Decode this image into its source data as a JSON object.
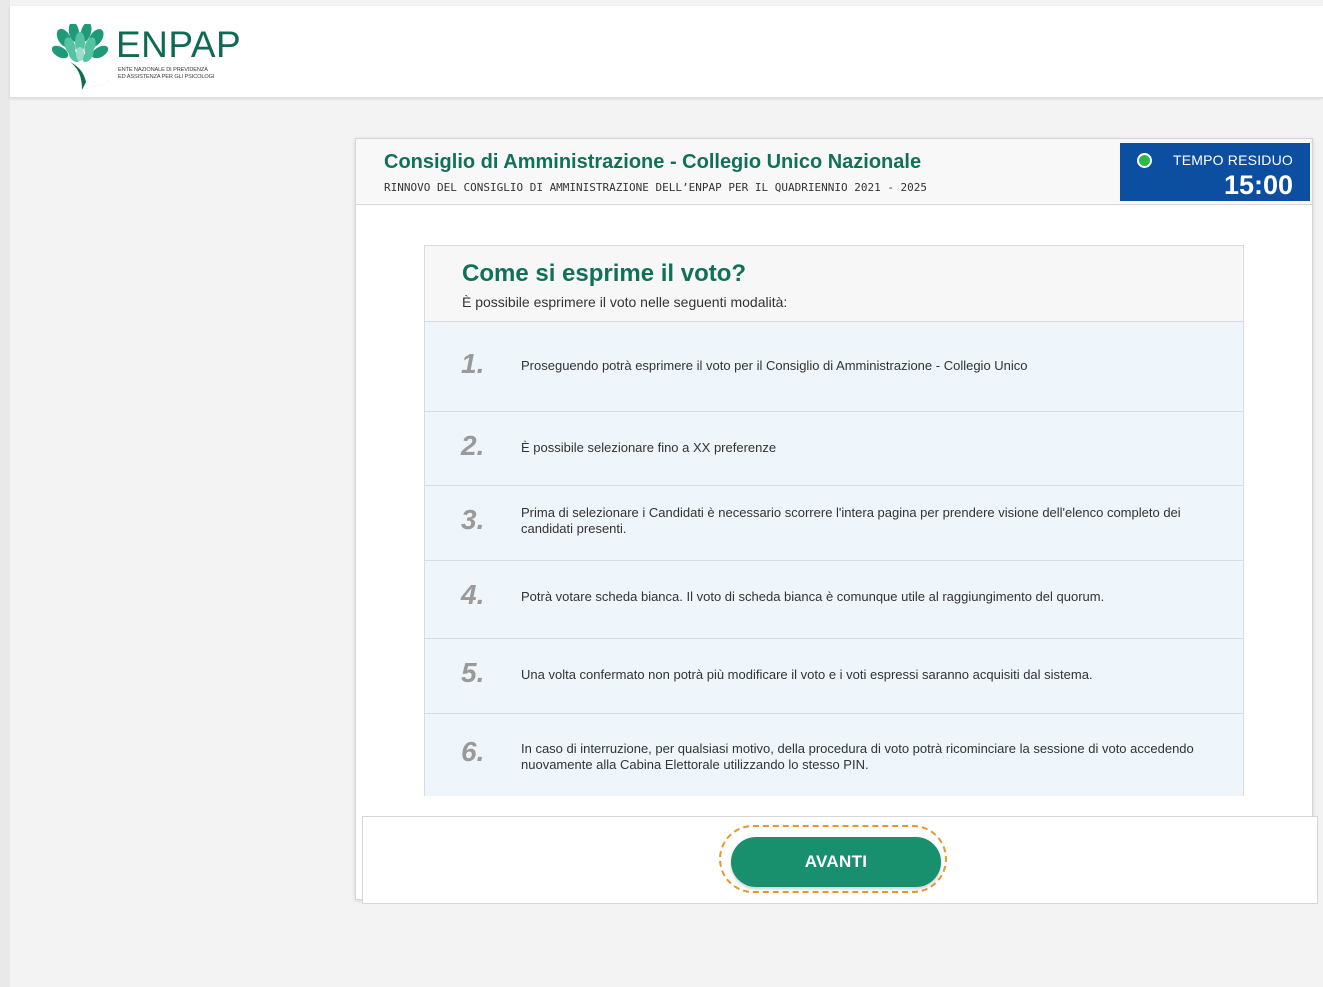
{
  "brand": {
    "name": "ENPAP",
    "subtitle_line1": "ENTE NAZIONALE DI PREVIDENZA",
    "subtitle_line2": "ED ASSISTENZA PER GLI PSICOLOGI",
    "color": "#0e6a52"
  },
  "panel": {
    "title": "Consiglio di Amministrazione - Collegio Unico Nazionale",
    "subtitle": "RINNOVO DEL CONSIGLIO DI AMMINISTRAZIONE DELL’ENPAP PER IL QUADRIENNIO  2021 - 2025"
  },
  "timer": {
    "label": "TEMPO RESIDUO",
    "value": "15:00",
    "status_color": "#2db84a",
    "bg_color": "#0c4ea0"
  },
  "info": {
    "title": "Come si esprime il voto?",
    "description": "È possibile esprimere il voto nelle seguenti modalità:",
    "items": [
      {
        "num": "1.",
        "text": "Proseguendo potrà esprimere il voto per il Consiglio di Amministrazione - Collegio Unico"
      },
      {
        "num": "2.",
        "text": "È possibile selezionare fino a XX preferenze"
      },
      {
        "num": "3.",
        "text": "Prima di selezionare i Candidati è necessario scorrere l'intera pagina per prendere visione dell'elenco completo dei candidati presenti."
      },
      {
        "num": "4.",
        "text": "Potrà votare scheda bianca. Il voto di scheda bianca è comunque utile al raggiungimento del quorum."
      },
      {
        "num": "5.",
        "text": "Una volta confermato non potrà più modificare il voto e i voti espressi saranno acquisiti dal sistema."
      },
      {
        "num": "6.",
        "text": "In caso di interruzione, per qualsiasi motivo, della procedura di voto potrà ricominciare la sessione di voto accedendo nuovamente alla Cabina Elettorale utilizzando lo stesso PIN."
      }
    ]
  },
  "footer": {
    "next_label": "AVANTI",
    "button_color": "#18906d",
    "highlight_color": "#e8962e"
  }
}
